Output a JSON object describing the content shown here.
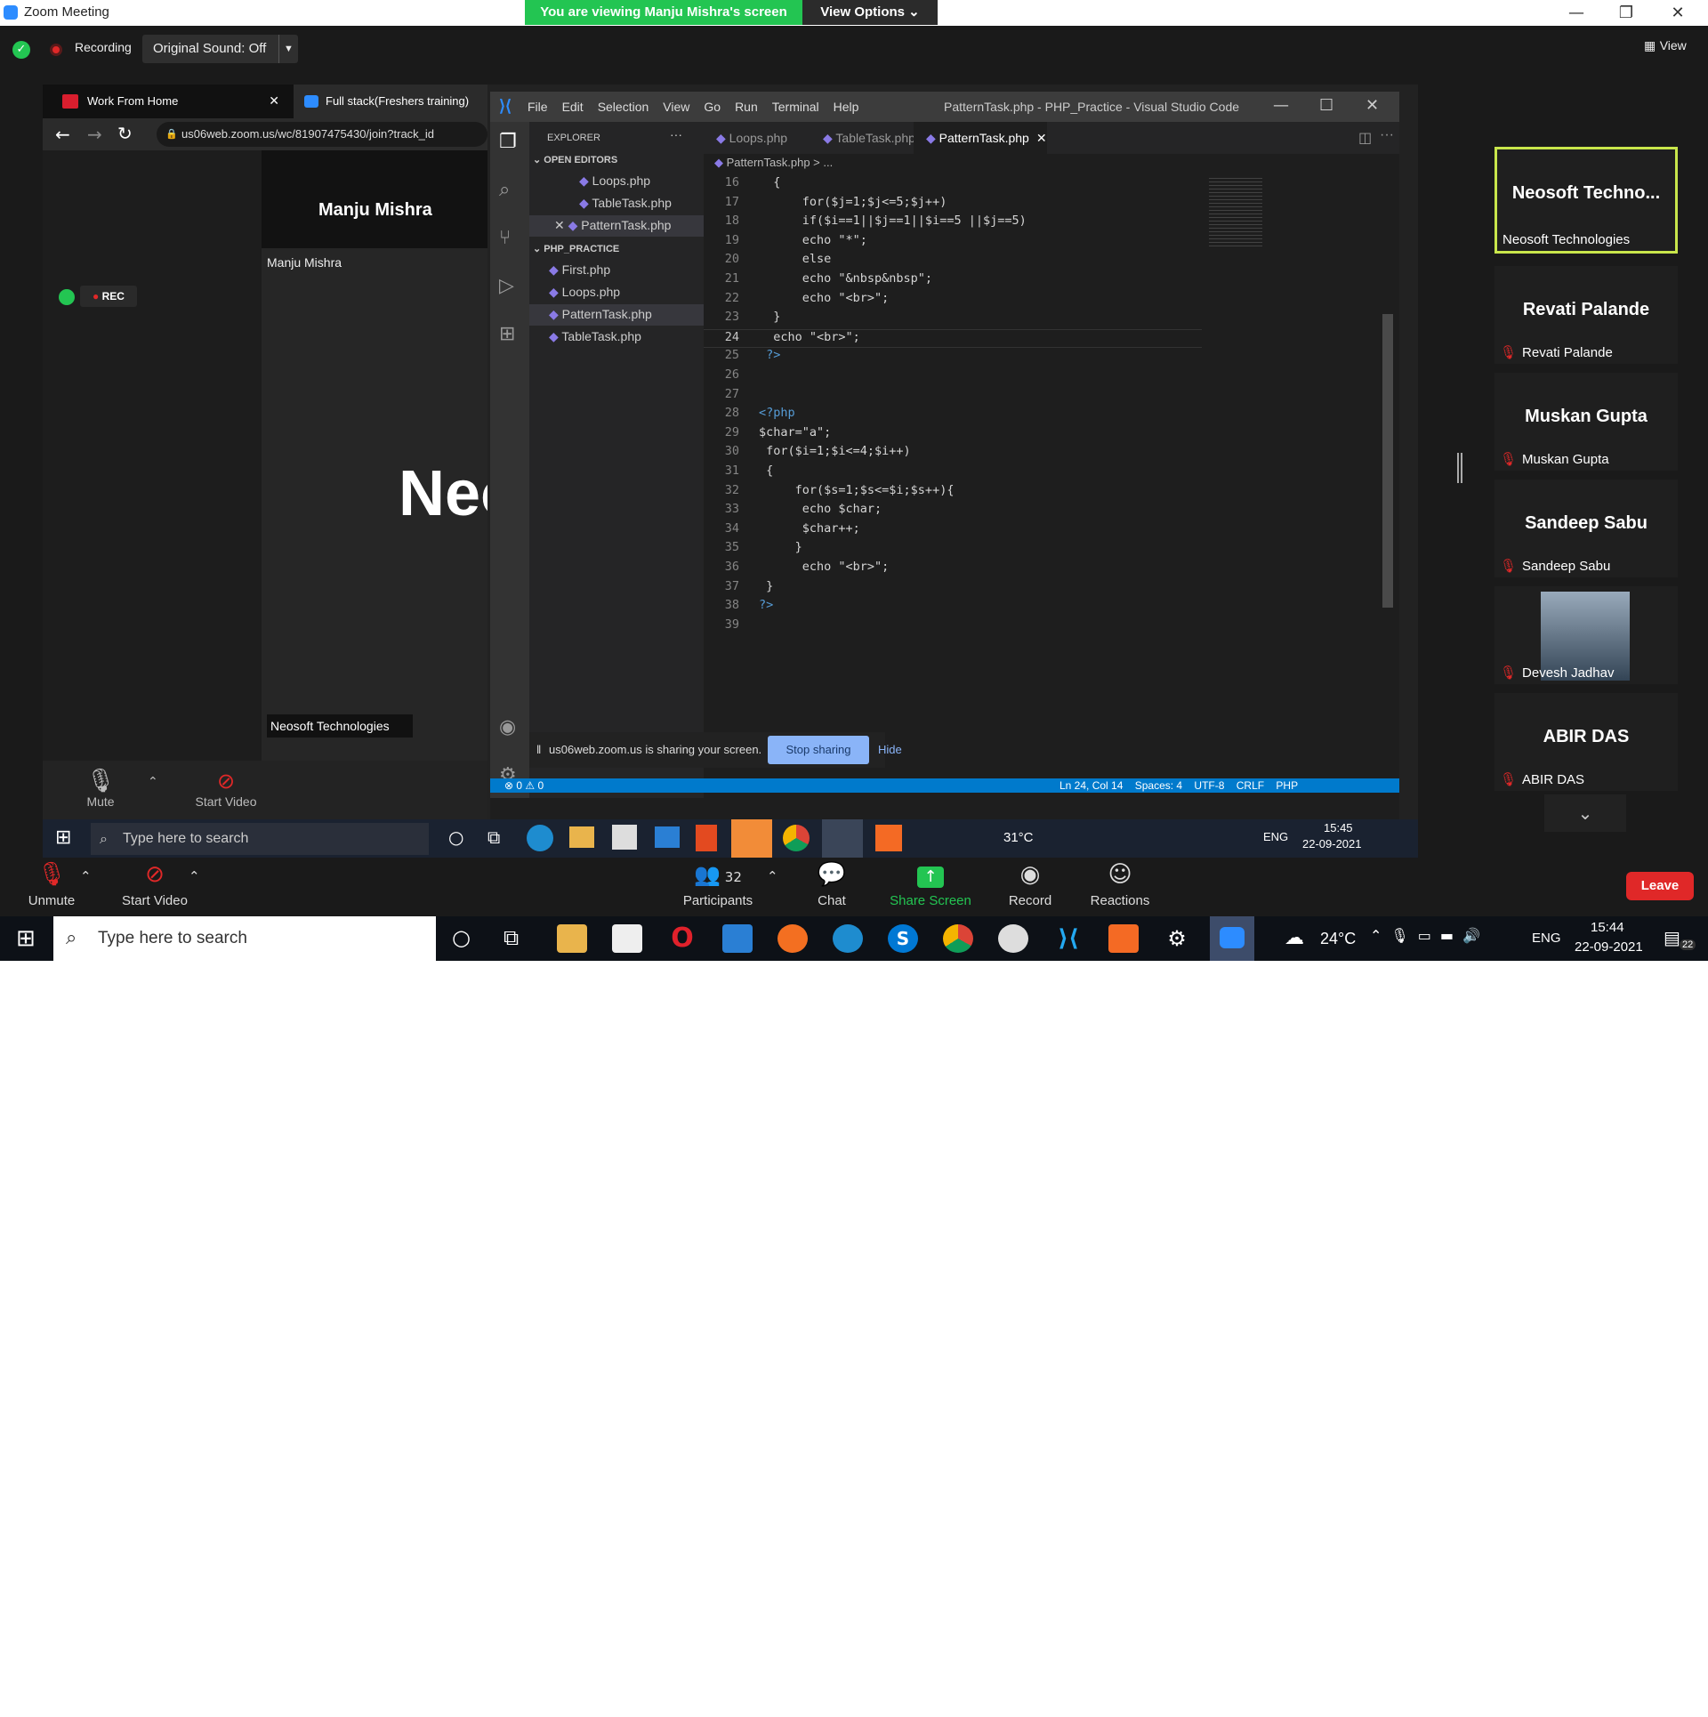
{
  "window": {
    "title": "Zoom Meeting",
    "banner": "You are viewing Manju Mishra's screen",
    "view_options": "View Options ⌄",
    "minimize": "—",
    "restore": "❐",
    "close": "✕"
  },
  "topbar": {
    "recording": "Recording",
    "original_sound": "Original Sound: Off",
    "view": "View"
  },
  "browser": {
    "tabs": [
      "Work From Home",
      "Full stack(Freshers training)"
    ],
    "url": "us06web.zoom.us/wc/81907475430/join?track_id",
    "speaker_name": "Manju Mishra",
    "name_tag": "Manju Mishra",
    "rec": "REC",
    "big_text": "Neo",
    "bottom_tag": "Neosoft Technologies",
    "mute": "Mute",
    "start_video": "Start Video"
  },
  "vscode": {
    "menu": [
      "File",
      "Edit",
      "Selection",
      "View",
      "Go",
      "Run",
      "Terminal",
      "Help"
    ],
    "title": "PatternTask.php - PHP_Practice - Visual Studio Code",
    "tabs": [
      "Loops.php",
      "TableTask.php",
      "PatternTask.php"
    ],
    "breadcrumb": "PatternTask.php > ...",
    "explorer": "EXPLORER",
    "open_editors": "OPEN EDITORS",
    "open_files": [
      "Loops.php",
      "TableTask.php",
      "PatternTask.php"
    ],
    "folder": "PHP_PRACTICE",
    "folder_files": [
      "First.php",
      "Loops.php",
      "PatternTask.php",
      "TableTask.php"
    ],
    "lines": [
      {
        "n": "16",
        "t": "  {"
      },
      {
        "n": "17",
        "t": "      for($j=1;$j<=5;$j++)"
      },
      {
        "n": "18",
        "t": "      if($i==1||$j==1||$i==5 ||$j==5)"
      },
      {
        "n": "19",
        "t": "      echo \"*\";"
      },
      {
        "n": "20",
        "t": "      else"
      },
      {
        "n": "21",
        "t": "      echo \"&nbsp&nbsp\";"
      },
      {
        "n": "22",
        "t": "      echo \"<br>\";"
      },
      {
        "n": "23",
        "t": "  }"
      },
      {
        "n": "24",
        "t": "  echo \"<br>\";"
      },
      {
        "n": "25",
        "t": " ?>"
      },
      {
        "n": "26",
        "t": ""
      },
      {
        "n": "27",
        "t": ""
      },
      {
        "n": "28",
        "t": "<?php"
      },
      {
        "n": "29",
        "t": "$char=\"a\";"
      },
      {
        "n": "30",
        "t": " for($i=1;$i<=4;$i++)"
      },
      {
        "n": "31",
        "t": " {"
      },
      {
        "n": "32",
        "t": "     for($s=1;$s<=$i;$s++){"
      },
      {
        "n": "33",
        "t": "      echo $char;"
      },
      {
        "n": "34",
        "t": "      $char++;"
      },
      {
        "n": "35",
        "t": "     }"
      },
      {
        "n": "36",
        "t": "      echo \"<br>\";"
      },
      {
        "n": "37",
        "t": " }"
      },
      {
        "n": "38",
        "t": "?>"
      },
      {
        "n": "39",
        "t": ""
      }
    ],
    "share_msg": "us06web.zoom.us is sharing your screen.",
    "stop_sharing": "Stop sharing",
    "hide": "Hide",
    "status_left": "⊗ 0 ⚠ 0",
    "status_right": "Ln 24, Col 14    Spaces: 4    UTF-8    CRLF    PHP"
  },
  "inner_taskbar": {
    "search": "Type here to search",
    "temp": "31°C",
    "lang": "ENG",
    "time": "15:45",
    "date": "22-09-2021"
  },
  "gallery": [
    {
      "name": "Neosoft  Techno...",
      "label": "Neosoft Technologies"
    },
    {
      "name": "Revati Palande",
      "label": "Revati Palande"
    },
    {
      "name": "Muskan Gupta",
      "label": "Muskan Gupta"
    },
    {
      "name": "Sandeep Sabu",
      "label": "Sandeep Sabu"
    },
    {
      "name": "",
      "label": "Devesh Jadhav"
    },
    {
      "name": "ABIR DAS",
      "label": "ABIR DAS"
    }
  ],
  "toolbar": {
    "unmute": "Unmute",
    "start_video": "Start Video",
    "participants": "Participants",
    "participants_count": "32",
    "chat": "Chat",
    "share": "Share Screen",
    "record": "Record",
    "reactions": "Reactions",
    "leave": "Leave"
  },
  "taskbar": {
    "search": "Type here to search",
    "temp": "24°C",
    "lang": "ENG",
    "time": "15:44",
    "date": "22-09-2021",
    "notif": "22"
  },
  "colors": {
    "zoom_blue": "#2d8cff",
    "green": "#23c552",
    "leave": "#e02828",
    "vs_blue": "#007acc"
  }
}
